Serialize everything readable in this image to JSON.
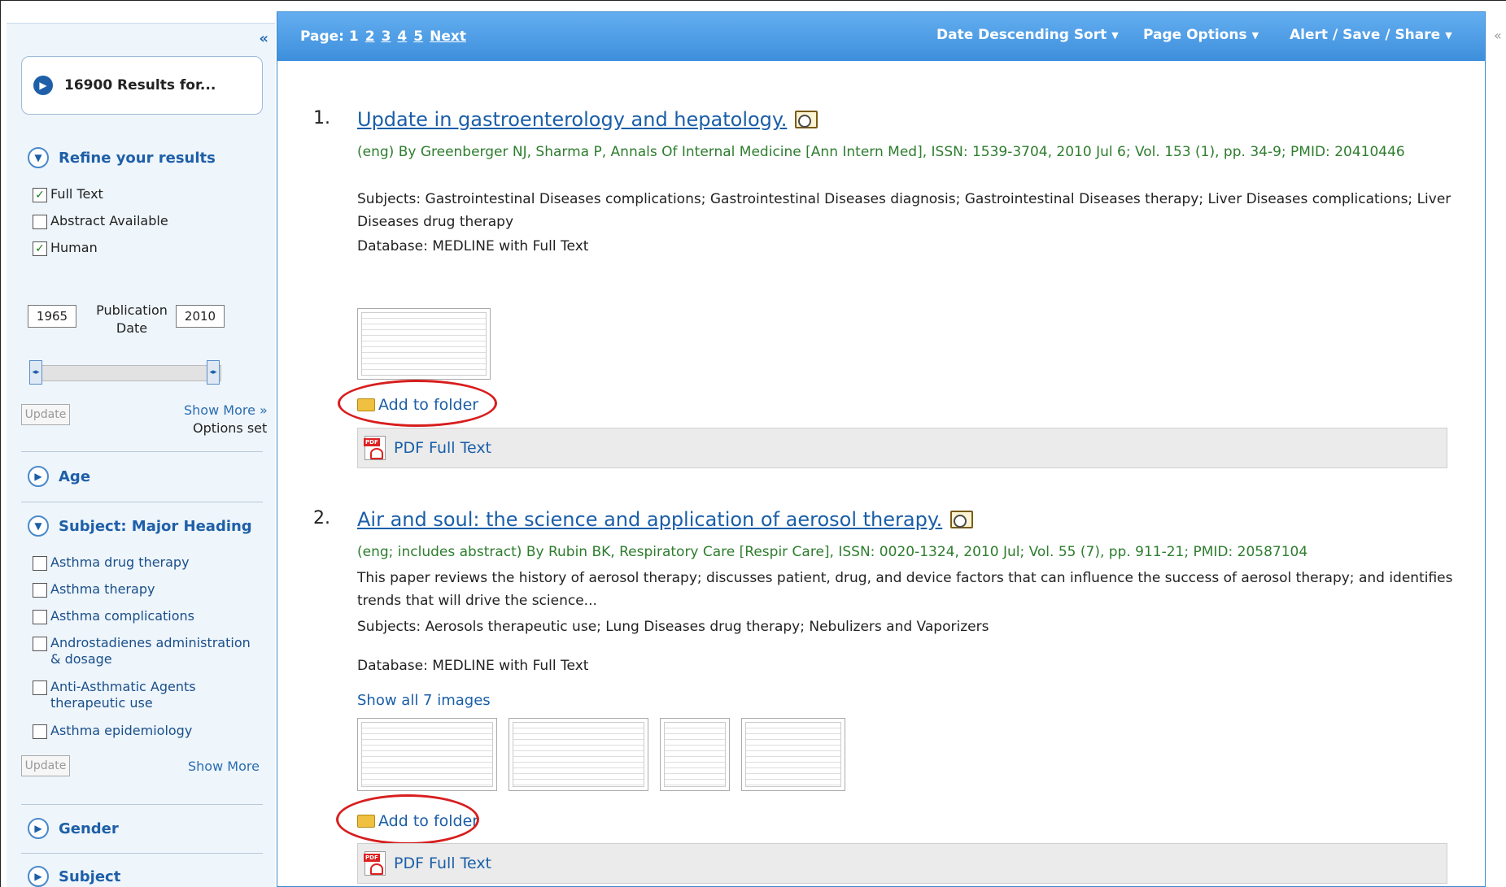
{
  "sidebar": {
    "collapse": "«",
    "results_count": "16900 Results for...",
    "refine_title": "Refine your results",
    "refine_items": [
      {
        "label": "Full Text",
        "checked": true
      },
      {
        "label": "Abstract Available",
        "checked": false
      },
      {
        "label": "Human",
        "checked": true
      }
    ],
    "pub_from": "1965",
    "pub_to": "2010",
    "pub_label": "Publication Date",
    "update": "Update",
    "show_more_arrow": "Show More »",
    "options_set": "Options set",
    "age": "Age",
    "major_heading": "Subject: Major Heading",
    "headings": [
      "Asthma drug therapy",
      "Asthma therapy",
      "Asthma complications",
      "Androstadienes administration & dosage",
      "Anti-Asthmatic Agents therapeutic use",
      "Asthma epidemiology"
    ],
    "show_more": "Show More",
    "gender": "Gender",
    "subject": "Subject"
  },
  "topbar": {
    "page_label": "Page: 1",
    "pages": [
      "2",
      "3",
      "4",
      "5",
      "Next"
    ],
    "sort": "Date Descending Sort",
    "page_options": "Page Options",
    "alert": "Alert / Save / Share",
    "collapse_right": "«"
  },
  "results": [
    {
      "num": "1.",
      "title": "Update in gastroenterology and hepatology.",
      "meta": "(eng) By Greenberger NJ, Sharma P, Annals Of Internal Medicine [Ann Intern Med], ISSN: 1539-3704, 2010 Jul 6; Vol. 153 (1), pp. 34-9; PMID: 20410446",
      "subjects": "Subjects: Gastrointestinal Diseases complications; Gastrointestinal Diseases diagnosis; Gastrointestinal Diseases therapy; Liver Diseases complications; Liver Diseases drug therapy",
      "database": "Database: MEDLINE with Full Text",
      "add_folder": "Add to folder",
      "pdf": "PDF Full Text"
    },
    {
      "num": "2.",
      "title": "Air and soul: the science and application of aerosol therapy.",
      "meta": "(eng; includes abstract) By Rubin BK, Respiratory Care [Respir Care], ISSN: 0020-1324, 2010 Jul; Vol. 55 (7), pp. 911-21; PMID: 20587104",
      "abstract": "This paper reviews the history of aerosol therapy; discusses patient, drug, and device factors that can influence the success of aerosol therapy; and identifies trends that will drive the science...",
      "subjects": "Subjects: Aerosols therapeutic use; Lung Diseases drug therapy; Nebulizers and Vaporizers",
      "database": "Database: MEDLINE with Full Text",
      "show_images": "Show all 7 images",
      "add_folder": "Add to folder",
      "pdf": "PDF Full Text"
    }
  ]
}
